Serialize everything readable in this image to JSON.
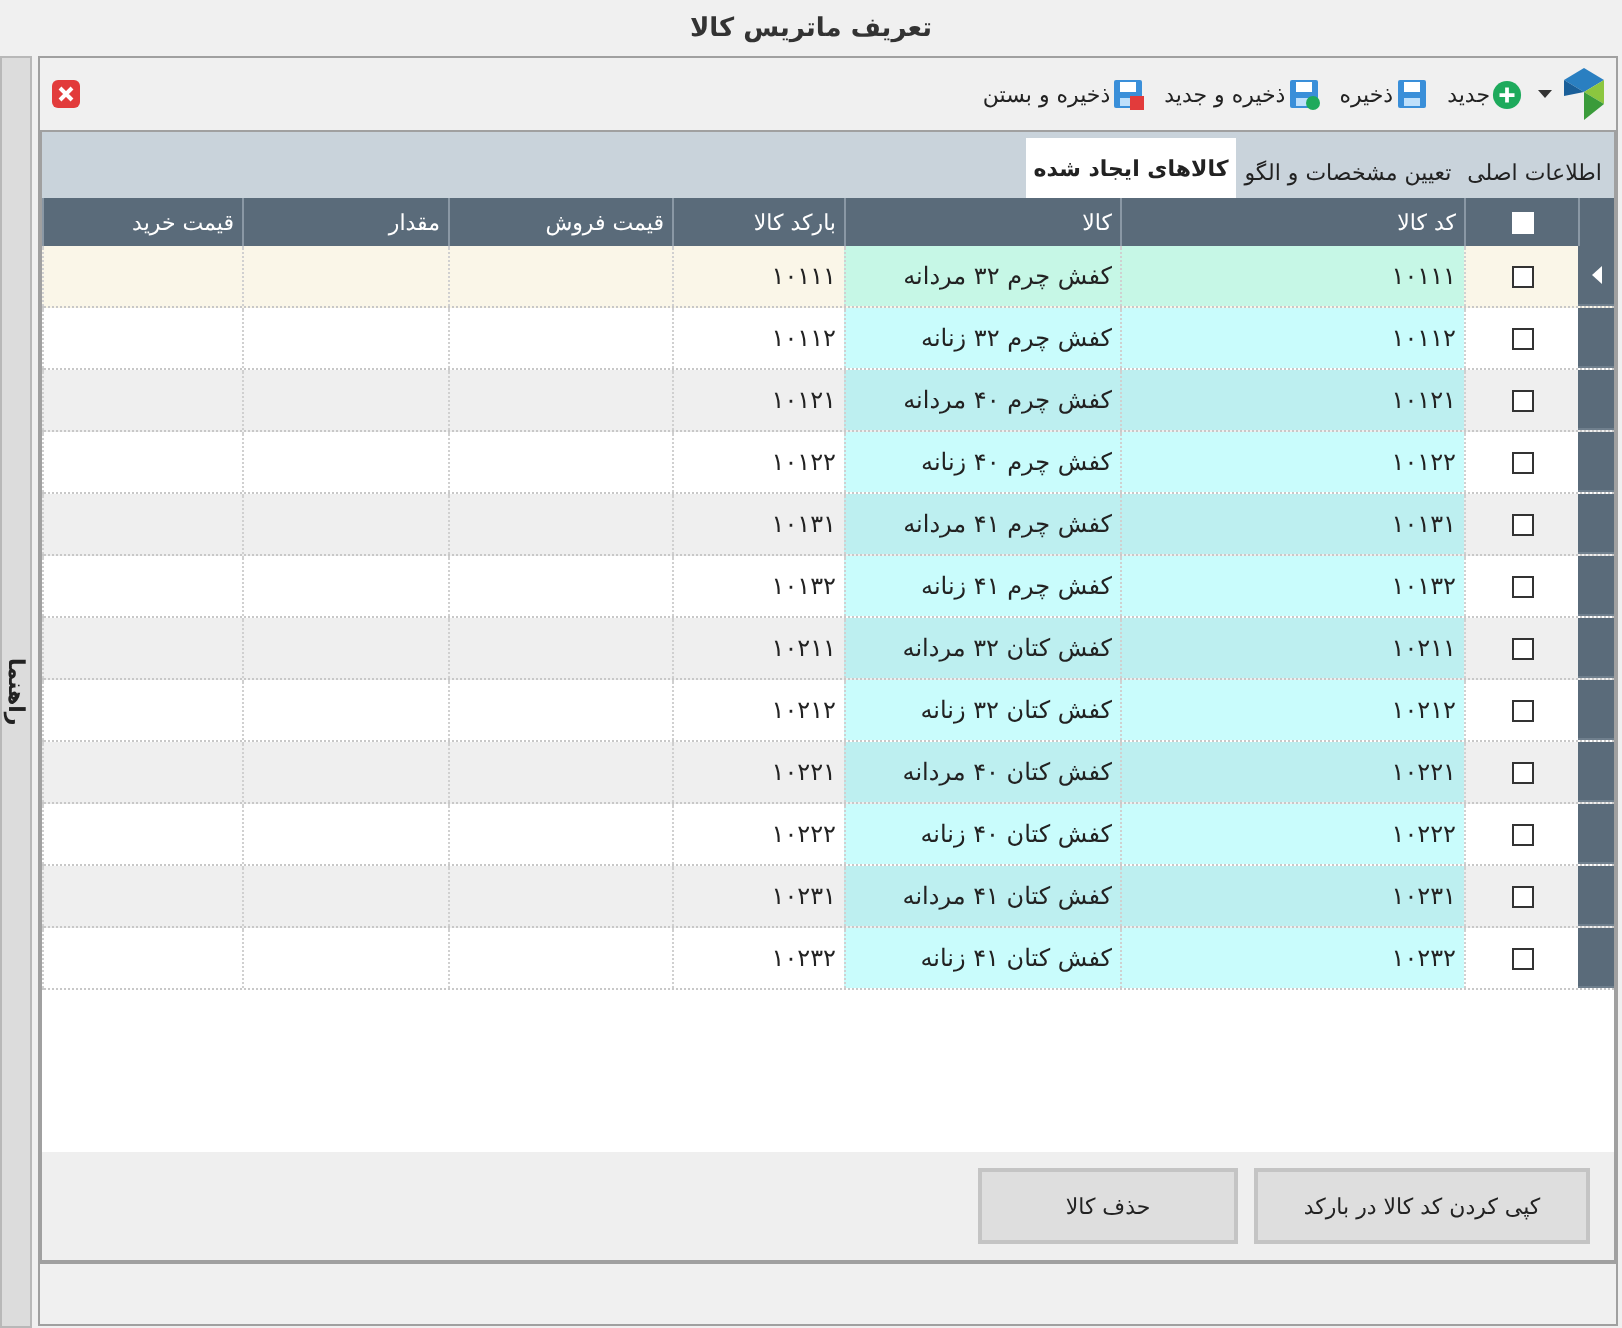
{
  "window": {
    "title": "تعریف ماتریس کالا"
  },
  "side_tab": {
    "label": "راهنما"
  },
  "toolbar": {
    "buttons": [
      {
        "kind": "new",
        "label": "جدید"
      },
      {
        "kind": "save",
        "label": "ذخیره"
      },
      {
        "kind": "save_new",
        "label": "ذخیره و جدید"
      },
      {
        "kind": "save_close",
        "label": "ذخیره و بستن"
      }
    ]
  },
  "tabs": [
    {
      "label": "اطلاعات اصلی",
      "selected": false
    },
    {
      "label": "تعیین مشخصات و الگو",
      "selected": false
    },
    {
      "label": "کالاهای ایجاد شده",
      "selected": true
    }
  ],
  "table": {
    "header_checked": false,
    "columns": [
      "کد کالا",
      "کالا",
      "بارکد کالا",
      "قیمت فروش",
      "مقدار",
      "قیمت خرید"
    ],
    "rows": [
      {
        "selected": true,
        "checked": false,
        "code": "۱۰۱۱۱",
        "name": "کفش چرم ۳۲ مردانه",
        "barcode": "۱۰۱۱۱"
      },
      {
        "selected": false,
        "checked": false,
        "code": "۱۰۱۱۲",
        "name": "کفش چرم ۳۲ زنانه",
        "barcode": "۱۰۱۱۲"
      },
      {
        "selected": false,
        "checked": false,
        "code": "۱۰۱۲۱",
        "name": "کفش چرم ۴۰ مردانه",
        "barcode": "۱۰۱۲۱"
      },
      {
        "selected": false,
        "checked": false,
        "code": "۱۰۱۲۲",
        "name": "کفش چرم ۴۰ زنانه",
        "barcode": "۱۰۱۲۲"
      },
      {
        "selected": false,
        "checked": false,
        "code": "۱۰۱۳۱",
        "name": "کفش چرم ۴۱ مردانه",
        "barcode": "۱۰۱۳۱"
      },
      {
        "selected": false,
        "checked": false,
        "code": "۱۰۱۳۲",
        "name": "کفش چرم ۴۱ زنانه",
        "barcode": "۱۰۱۳۲"
      },
      {
        "selected": false,
        "checked": false,
        "code": "۱۰۲۱۱",
        "name": "کفش کتان ۳۲ مردانه",
        "barcode": "۱۰۲۱۱"
      },
      {
        "selected": false,
        "checked": false,
        "code": "۱۰۲۱۲",
        "name": "کفش کتان ۳۲ زنانه",
        "barcode": "۱۰۲۱۲"
      },
      {
        "selected": false,
        "checked": false,
        "code": "۱۰۲۲۱",
        "name": "کفش کتان ۴۰ مردانه",
        "barcode": "۱۰۲۲۱"
      },
      {
        "selected": false,
        "checked": false,
        "code": "۱۰۲۲۲",
        "name": "کفش کتان ۴۰ زنانه",
        "barcode": "۱۰۲۲۲"
      },
      {
        "selected": false,
        "checked": false,
        "code": "۱۰۲۳۱",
        "name": "کفش کتان ۴۱ مردانه",
        "barcode": "۱۰۲۳۱"
      },
      {
        "selected": false,
        "checked": false,
        "code": "۱۰۲۳۲",
        "name": "کفش کتان ۴۱ زنانه",
        "barcode": "۱۰۲۳۲"
      }
    ]
  },
  "buttons": [
    "کپی کردن کد کالا در بارکد",
    "حذف کالا"
  ]
}
